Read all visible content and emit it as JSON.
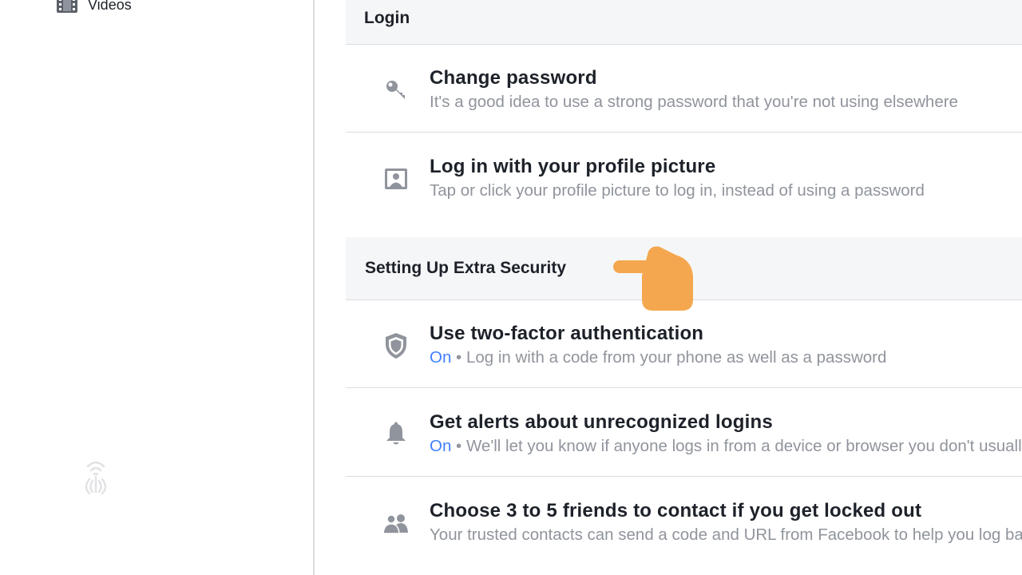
{
  "sidebar": {
    "items": [
      {
        "label": "Videos",
        "icon": "film-icon"
      }
    ]
  },
  "sections": {
    "login": {
      "header": "Login",
      "rows": [
        {
          "title": "Change password",
          "description": "It's a good idea to use a strong password that you're not using elsewhere",
          "icon": "key-icon"
        },
        {
          "title": "Log in with your profile picture",
          "description": "Tap or click your profile picture to log in, instead of using a password",
          "icon": "profile-picture-icon"
        }
      ]
    },
    "extra_security": {
      "header": "Setting Up Extra Security",
      "rows": [
        {
          "title": "Use two-factor authentication",
          "status": "On",
          "separator": " • ",
          "description": "Log in with a code from your phone as well as a password",
          "icon": "shield-icon"
        },
        {
          "title": "Get alerts about unrecognized logins",
          "status": "On",
          "separator": " • ",
          "description": "We'll let you know if anyone logs in from a device or browser you don't usually use",
          "icon": "bell-icon"
        },
        {
          "title": "Choose 3 to 5 friends to contact if you get locked out",
          "description": "Your trusted contacts can send a code and URL from Facebook to help you log back in",
          "icon": "friends-icon"
        }
      ]
    }
  },
  "colors": {
    "status_on": "#4080ff",
    "pointer_hand": "#f4a74f",
    "header_bg": "#f5f6f7"
  }
}
